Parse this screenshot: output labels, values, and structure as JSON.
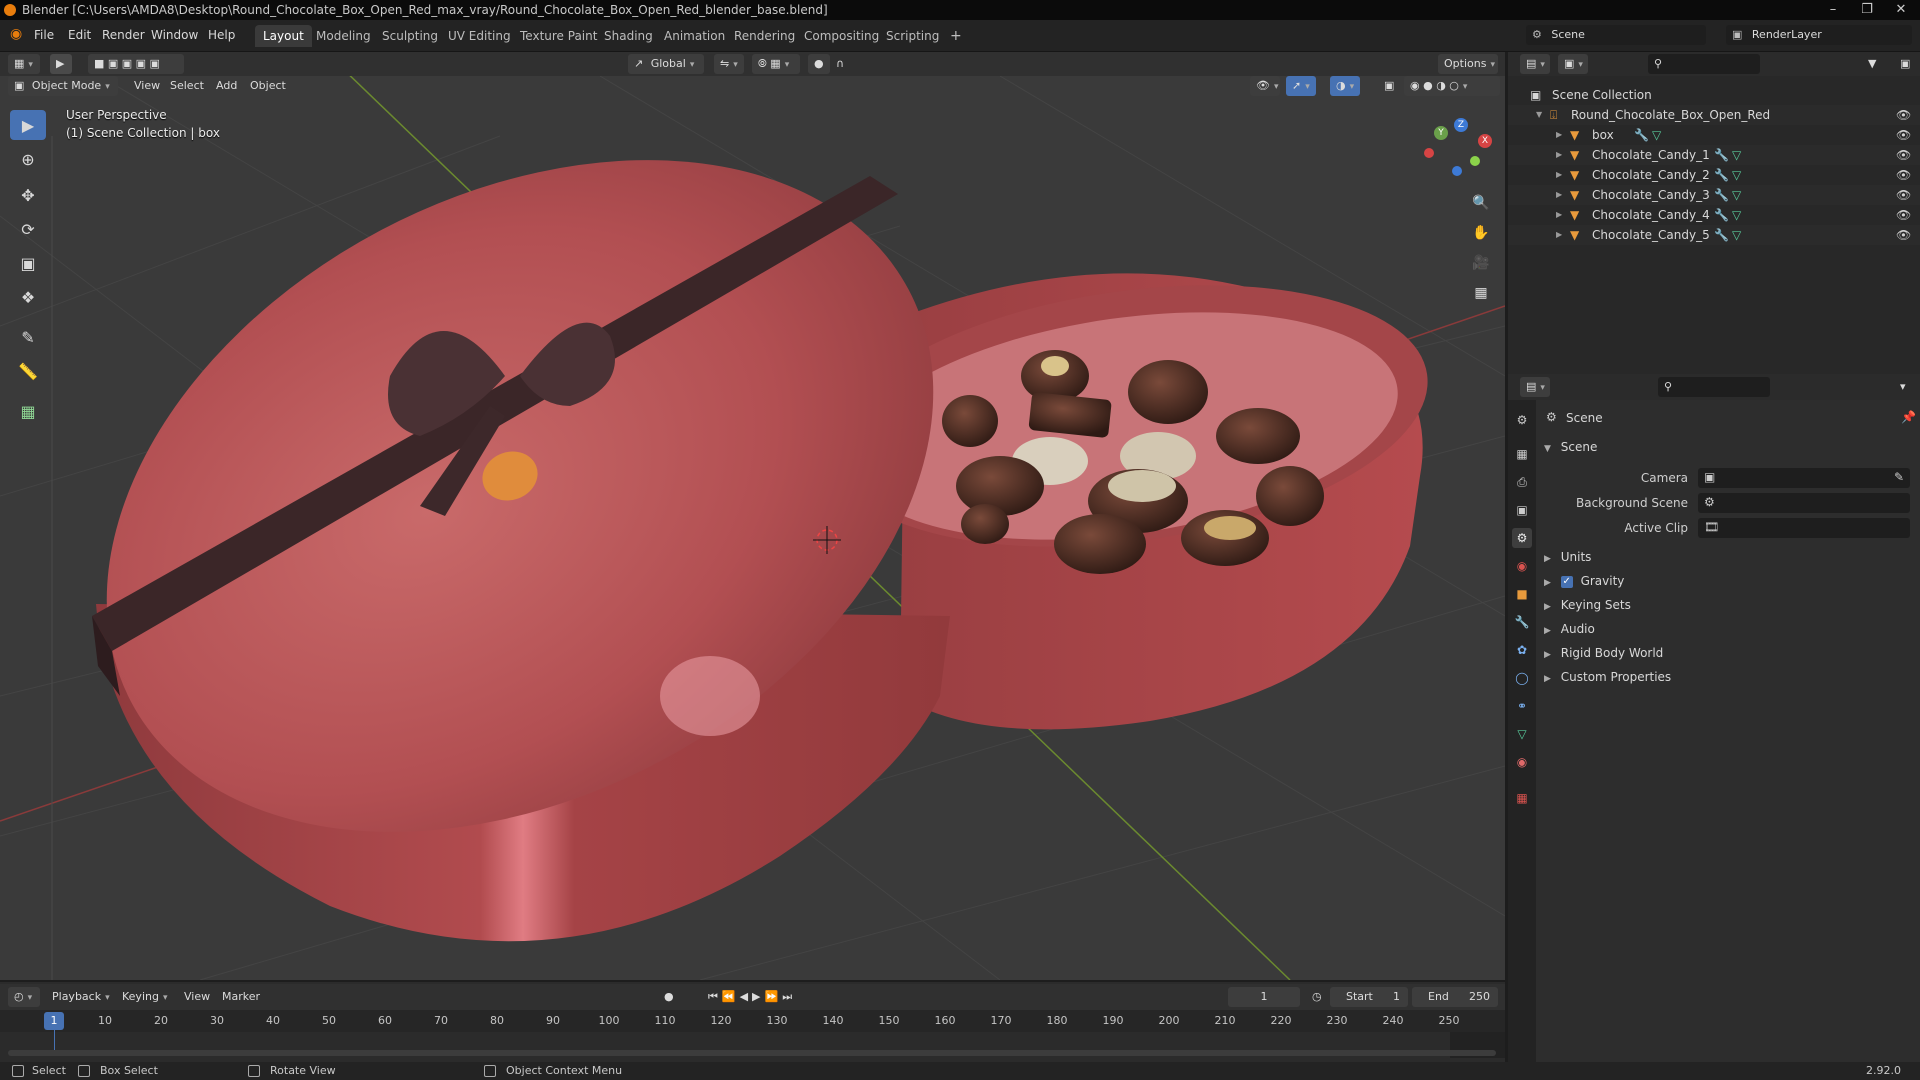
{
  "window": {
    "title": "Blender [C:\\Users\\AMDA8\\Desktop\\Round_Chocolate_Box_Open_Red_max_vray/Round_Chocolate_Box_Open_Red_blender_base.blend]"
  },
  "menu": {
    "file": "File",
    "edit": "Edit",
    "render": "Render",
    "window": "Window",
    "help": "Help"
  },
  "workspaces": [
    "Layout",
    "Modeling",
    "Sculpting",
    "UV Editing",
    "Texture Paint",
    "Shading",
    "Animation",
    "Rendering",
    "Compositing",
    "Scripting"
  ],
  "scene_selector": {
    "label": "Scene",
    "renderlayer": "RenderLayer"
  },
  "toolheader": {
    "orientation": "Global",
    "options": "Options"
  },
  "viewport_header": {
    "mode": "Object Mode",
    "view": "View",
    "select": "Select",
    "add": "Add",
    "object": "Object"
  },
  "viewport": {
    "perspective": "User Perspective",
    "collection_info": "(1) Scene Collection | box",
    "gizmo": {
      "x": "X",
      "y": "Y",
      "z": "Z"
    }
  },
  "outliner": {
    "root": "Scene Collection",
    "collection": "Round_Chocolate_Box_Open_Red",
    "objects": [
      "box",
      "Chocolate_Candy_1",
      "Chocolate_Candy_2",
      "Chocolate_Candy_3",
      "Chocolate_Candy_4",
      "Chocolate_Candy_5"
    ]
  },
  "properties": {
    "context": "Scene",
    "section": "Scene",
    "fields": {
      "camera": "Camera",
      "background_scene": "Background Scene",
      "active_clip": "Active Clip"
    },
    "panels": [
      "Units",
      "Gravity",
      "Keying Sets",
      "Audio",
      "Rigid Body World",
      "Custom Properties"
    ],
    "gravity_checked": true
  },
  "timeline": {
    "playback": "Playback",
    "keying": "Keying",
    "view": "View",
    "marker": "Marker",
    "current_frame": "1",
    "start_label": "Start",
    "start": "1",
    "end_label": "End",
    "end": "250",
    "ticks": [
      "1",
      "10",
      "20",
      "30",
      "40",
      "50",
      "60",
      "70",
      "80",
      "90",
      "100",
      "110",
      "120",
      "130",
      "140",
      "150",
      "160",
      "170",
      "180",
      "190",
      "200",
      "210",
      "220",
      "230",
      "240",
      "250"
    ]
  },
  "status": {
    "select": "Select",
    "box_select": "Box Select",
    "rotate_view": "Rotate View",
    "context_menu": "Object Context Menu",
    "version": "2.92.0"
  }
}
